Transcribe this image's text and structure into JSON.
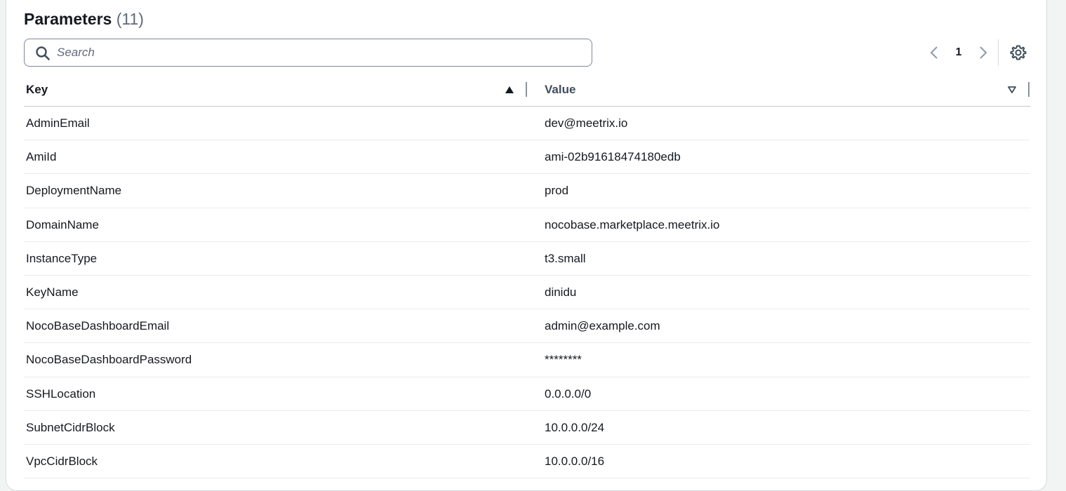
{
  "header": {
    "title": "Parameters",
    "count": "(11)"
  },
  "search": {
    "placeholder": "Search",
    "value": ""
  },
  "pagination": {
    "current_page": "1"
  },
  "table": {
    "columns": [
      {
        "label": "Key",
        "sort": "ascending"
      },
      {
        "label": "Value",
        "sort": "none"
      }
    ],
    "rows": [
      {
        "key": "AdminEmail",
        "value": "dev@meetrix.io"
      },
      {
        "key": "AmiId",
        "value": "ami-02b91618474180edb"
      },
      {
        "key": "DeploymentName",
        "value": "prod"
      },
      {
        "key": "DomainName",
        "value": "nocobase.marketplace.meetrix.io"
      },
      {
        "key": "InstanceType",
        "value": "t3.small"
      },
      {
        "key": "KeyName",
        "value": "dinidu"
      },
      {
        "key": "NocoBaseDashboardEmail",
        "value": "admin@example.com"
      },
      {
        "key": "NocoBaseDashboardPassword",
        "value": "********"
      },
      {
        "key": "SSHLocation",
        "value": "0.0.0.0/0"
      },
      {
        "key": "SubnetCidrBlock",
        "value": "10.0.0.0/24"
      },
      {
        "key": "VpcCidrBlock",
        "value": "10.0.0.0/16"
      }
    ]
  },
  "icons": {
    "search": "search-icon",
    "prev": "chevron-left-icon",
    "next": "chevron-right-icon",
    "settings": "gear-icon",
    "sort_asc": "sort-ascending-icon",
    "sort_none": "sort-descending-outline-icon"
  },
  "colors": {
    "text": "#16191f",
    "muted": "#5f6b7a",
    "border": "#7d8998",
    "divider": "#e9ebed"
  }
}
